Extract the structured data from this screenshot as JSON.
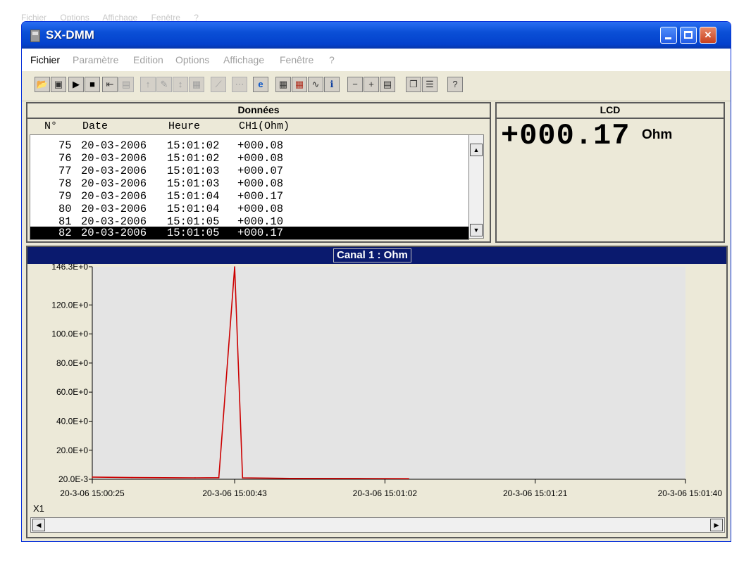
{
  "background_menu": [
    "Fichier",
    "Options",
    "Affichage",
    "Fenêtre",
    "?"
  ],
  "window": {
    "title": "SX-DMM",
    "title_color": "#0a4fd6"
  },
  "menu": [
    {
      "label": "Fichier",
      "enabled": true
    },
    {
      "label": "Paramètre",
      "enabled": false
    },
    {
      "label": "Edition",
      "enabled": false
    },
    {
      "label": "Options",
      "enabled": false
    },
    {
      "label": "Affichage",
      "enabled": false
    },
    {
      "label": "Fenêtre",
      "enabled": false
    },
    {
      "label": "?",
      "enabled": false
    }
  ],
  "toolbar_icons": [
    "open-icon",
    "save-icon",
    "play-icon",
    "stop-icon",
    "import-icon",
    "print-icon",
    "upload-icon",
    "config-icon",
    "probe-icon",
    "table-disabled-icon",
    "measure-icon",
    "disabled-icon",
    "internet-explorer-icon",
    "grid-icon",
    "chart-grid-icon",
    "curve-icon",
    "info-icon",
    "zoom-out-icon",
    "zoom-in-icon",
    "fit-icon",
    "cascade-icon",
    "tile-icon",
    "help-icon"
  ],
  "data_panel": {
    "title": "Données",
    "headers": {
      "n": "N°",
      "date": "Date",
      "time": "Heure",
      "value": "CH1(Ohm)"
    },
    "rows": [
      {
        "n": "75",
        "date": "20-03-2006",
        "time": "15:01:02",
        "value": "+000.08",
        "selected": false
      },
      {
        "n": "76",
        "date": "20-03-2006",
        "time": "15:01:02",
        "value": "+000.08",
        "selected": false
      },
      {
        "n": "77",
        "date": "20-03-2006",
        "time": "15:01:03",
        "value": "+000.07",
        "selected": false
      },
      {
        "n": "78",
        "date": "20-03-2006",
        "time": "15:01:03",
        "value": "+000.08",
        "selected": false
      },
      {
        "n": "79",
        "date": "20-03-2006",
        "time": "15:01:04",
        "value": "+000.17",
        "selected": false
      },
      {
        "n": "80",
        "date": "20-03-2006",
        "time": "15:01:04",
        "value": "+000.08",
        "selected": false
      },
      {
        "n": "81",
        "date": "20-03-2006",
        "time": "15:01:05",
        "value": "+000.10",
        "selected": false
      },
      {
        "n": "82",
        "date": "20-03-2006",
        "time": "15:01:05",
        "value": "+000.17",
        "selected": true
      }
    ]
  },
  "lcd_panel": {
    "title": "LCD",
    "value": "+000.17",
    "unit": "Ohm"
  },
  "chart_panel": {
    "title": "Canal 1 : Ohm",
    "zoom_label": "X1",
    "header_color": "#0a1a6e"
  },
  "chart_data": {
    "type": "line",
    "title": "Canal 1 : Ohm",
    "xlabel": "",
    "ylabel": "",
    "y_ticks": [
      {
        "value": 0.02,
        "label": "20.0E-3"
      },
      {
        "value": 20,
        "label": "20.0E+0"
      },
      {
        "value": 40,
        "label": "40.0E+0"
      },
      {
        "value": 60,
        "label": "60.0E+0"
      },
      {
        "value": 80,
        "label": "80.0E+0"
      },
      {
        "value": 100,
        "label": "100.0E+0"
      },
      {
        "value": 120,
        "label": "120.0E+0"
      },
      {
        "value": 146.3,
        "label": "146.3E+0"
      }
    ],
    "x_ticks": [
      {
        "value": "2006-03-20 15:00:25",
        "label": "20-3-06 15:00:25"
      },
      {
        "value": "2006-03-20 15:00:43",
        "label": "20-3-06 15:00:43"
      },
      {
        "value": "2006-03-20 15:01:02",
        "label": "20-3-06 15:01:02"
      },
      {
        "value": "2006-03-20 15:01:21",
        "label": "20-3-06 15:01:21"
      },
      {
        "value": "2006-03-20 15:01:40",
        "label": "20-3-06 15:01:40"
      }
    ],
    "xlim": [
      "2006-03-20 15:00:25",
      "2006-03-20 15:01:40"
    ],
    "ylim": [
      0.02,
      146.3
    ],
    "grid": false,
    "series": [
      {
        "color": "#cc0000",
        "x": [
          "2006-03-20 15:00:25",
          "2006-03-20 15:00:30",
          "2006-03-20 15:00:38",
          "2006-03-20 15:00:41",
          "2006-03-20 15:00:43",
          "2006-03-20 15:00:44",
          "2006-03-20 15:00:50",
          "2006-03-20 15:01:00",
          "2006-03-20 15:01:05"
        ],
        "y": [
          1.5,
          1.2,
          1.0,
          1.1,
          146.3,
          1.0,
          0.6,
          0.5,
          0.4
        ]
      }
    ]
  }
}
